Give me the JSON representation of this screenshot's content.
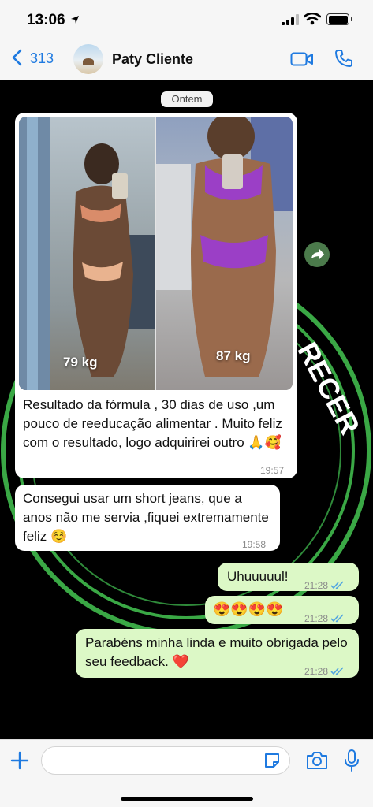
{
  "status_bar": {
    "time": "13:06",
    "icons": [
      "location-arrow-icon",
      "signal-icon",
      "wifi-icon",
      "battery-icon"
    ]
  },
  "header": {
    "back_count": "313",
    "contact_name": "Paty Cliente",
    "icons": [
      "chevron-left-icon",
      "video-call-icon",
      "phone-icon"
    ]
  },
  "chat": {
    "date_label": "Ontem",
    "background_text": "RECER",
    "messages": [
      {
        "direction": "incoming",
        "type": "image",
        "photo_labels": [
          "79 kg",
          "87 kg"
        ],
        "caption": "Resultado da fórmula , 30 dias de uso ,um pouco de reeducação alimentar . Muito feliz com o resultado, logo adquirirei outro 🙏🥰",
        "time": "19:57"
      },
      {
        "direction": "incoming",
        "type": "text",
        "text": "Consegui usar um short jeans, que a anos não me servia ,fiquei extremamente feliz ☺️",
        "time": "19:58"
      },
      {
        "direction": "outgoing",
        "type": "text",
        "text": "Uhuuuuul!",
        "time": "21:28",
        "status": "read"
      },
      {
        "direction": "outgoing",
        "type": "text",
        "text": "😍😍😍😍",
        "time": "21:28",
        "status": "read"
      },
      {
        "direction": "outgoing",
        "type": "text",
        "text": "Parabéns minha linda e muito obrigada pelo seu feedback. ❤️",
        "time": "21:28",
        "status": "read"
      }
    ]
  },
  "composer": {
    "placeholder": "",
    "icons": [
      "plus-icon",
      "sticker-icon",
      "camera-icon",
      "microphone-icon"
    ]
  },
  "colors": {
    "accent_blue": "#1f7ae0",
    "outgoing_bubble": "#dcf8c6",
    "incoming_bubble": "#ffffff",
    "read_ticks": "#53a6e0",
    "background_ring_green": "#3aa845"
  }
}
